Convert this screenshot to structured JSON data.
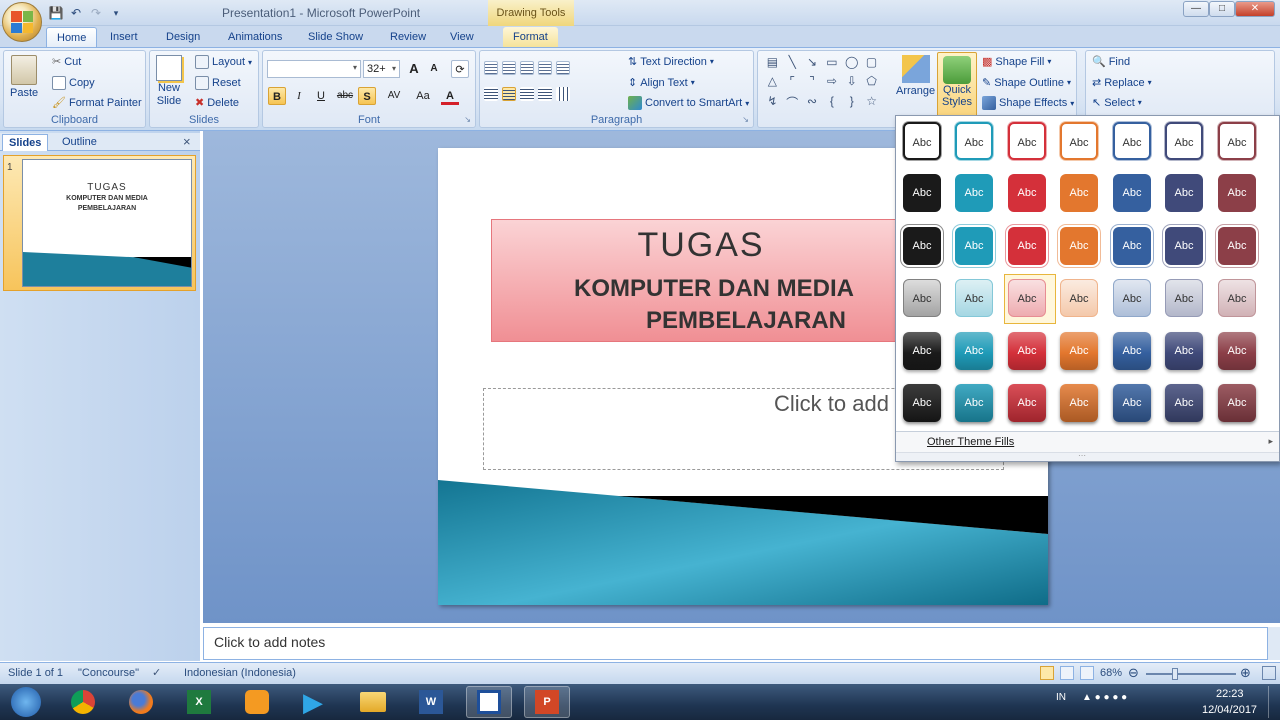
{
  "app": {
    "title": "Presentation1 - Microsoft PowerPoint",
    "context_tool": "Drawing Tools",
    "brand_color": "#15428b"
  },
  "tabs": [
    "Home",
    "Insert",
    "Design",
    "Animations",
    "Slide Show",
    "Review",
    "View",
    "Format"
  ],
  "clipboard": {
    "paste": "Paste",
    "cut": "Cut",
    "copy": "Copy",
    "format_painter": "Format Painter",
    "label": "Clipboard"
  },
  "slides_group": {
    "new_slide_line1": "New",
    "new_slide_line2": "Slide",
    "layout": "Layout",
    "reset": "Reset",
    "delete": "Delete",
    "label": "Slides"
  },
  "font": {
    "name": "",
    "size": "32+",
    "label": "Font",
    "bold": "B",
    "italic": "I",
    "underline": "U",
    "strike": "abc",
    "shadow": "S",
    "spacing": "AV",
    "change_case": "Aa",
    "color": "A",
    "grow": "A",
    "shrink": "A"
  },
  "paragraph": {
    "text_direction": "Text Direction",
    "align_text": "Align Text",
    "smartart": "Convert to SmartArt",
    "label": "Paragraph"
  },
  "drawing": {
    "arrange": "Arrange",
    "quick_styles_line1": "Quick",
    "quick_styles_line2": "Styles",
    "shape_fill": "Shape Fill",
    "shape_outline": "Shape Outline",
    "shape_effects": "Shape Effects"
  },
  "editing": {
    "find": "Find",
    "replace": "Replace",
    "select": "Select"
  },
  "panel": {
    "tab_slides": "Slides",
    "tab_outline": "Outline",
    "close": "×",
    "slide_number": "1"
  },
  "thumbnail": {
    "title": "TUGAS",
    "subtitle_line1": "KOMPUTER DAN MEDIA",
    "subtitle_line2": "PEMBELAJARAN"
  },
  "slide": {
    "title": "TUGAS",
    "subtitle_line1": "KOMPUTER DAN MEDIA",
    "subtitle_line2": "PEMBELAJARAN",
    "subtitle_placeholder": "Click to add subtitle"
  },
  "notes": {
    "placeholder": "Click to add notes"
  },
  "status": {
    "slide": "Slide 1 of 1",
    "theme": "\"Concourse\"",
    "language": "Indonesian (Indonesia)",
    "zoom": "68%"
  },
  "gallery": {
    "swatch_label": "Abc",
    "colors": [
      "#1a1a1a",
      "#1f9bb8",
      "#d4303a",
      "#e3772e",
      "#35609f",
      "#404a7a",
      "#8c3f48"
    ],
    "rows": [
      {
        "style": "outline"
      },
      {
        "style": "solid"
      },
      {
        "style": "solid-ring"
      },
      {
        "style": "light"
      },
      {
        "style": "gloss"
      },
      {
        "style": "intense"
      }
    ],
    "selected_row": 3,
    "selected_col": 2,
    "more": "Other Theme Fills"
  },
  "taskbar": {
    "lang": "IN",
    "time": "22:23",
    "date": "12/04/2017"
  }
}
